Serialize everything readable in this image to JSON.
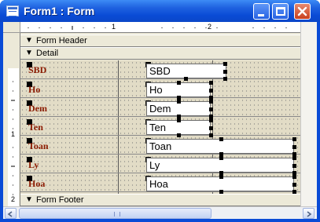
{
  "window": {
    "title": "Form1 : Form"
  },
  "ruler": {
    "h_marks": [
      "1",
      "2"
    ],
    "v_marks": [
      "1",
      "2"
    ]
  },
  "sections": {
    "header": "Form Header",
    "detail": "Detail",
    "footer": "Form Footer"
  },
  "fields": [
    {
      "label": "SBD",
      "control": "SBD"
    },
    {
      "label": "Ho",
      "control": "Ho"
    },
    {
      "label": "Dem",
      "control": "Dem"
    },
    {
      "label": "Ten",
      "control": "Ten"
    },
    {
      "label": "Toan",
      "control": "Toan"
    },
    {
      "label": "Ly",
      "control": "Ly"
    },
    {
      "label": "Hoa",
      "control": "Hoa"
    }
  ],
  "colors": {
    "title_bar": "#0a4bd6",
    "label_text": "#8b1a00",
    "detail_grid": "#e2dcc6"
  },
  "icons": [
    "app-form-icon",
    "minimize-icon",
    "maximize-icon",
    "close-icon",
    "section-arrow-icon",
    "scroll-left-icon",
    "scroll-right-icon"
  ]
}
